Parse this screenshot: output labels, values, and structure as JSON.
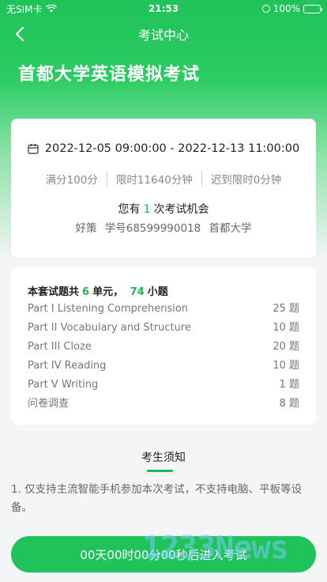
{
  "status_bar": {
    "carrier": "无SIM卡",
    "time": "21:53",
    "battery": "100%"
  },
  "nav": {
    "title": "考试中心"
  },
  "exam": {
    "title": "首都大学英语模拟考试",
    "time_range": "2022-12-05 09:00:00 - 2022-12-13 11:00:00",
    "full_score": "满分100分",
    "time_limit": "限时11640分钟",
    "late_limit": "迟到限时0分钟",
    "chance_prefix": "您有",
    "chance_count": "1",
    "chance_suffix": "次考试机会",
    "student_name": "好策",
    "student_id": "学号68599990018",
    "school": "首都大学"
  },
  "summary": {
    "prefix": "本套试题共",
    "units": "6",
    "units_label": "单元，",
    "questions": "74",
    "questions_label": "小题"
  },
  "parts": [
    {
      "name": "Part I Listening Comprehension",
      "count": "25 题"
    },
    {
      "name": "Part II Vocabulary and Structure",
      "count": "10 题"
    },
    {
      "name": "Part III Cloze",
      "count": "20 题"
    },
    {
      "name": "Part IV Reading",
      "count": "10 题"
    },
    {
      "name": "Part V Writing",
      "count": "1 题"
    },
    {
      "name": "问卷调查",
      "count": "8 题"
    }
  ],
  "notice": {
    "title": "考生须知",
    "text": "1. 仅支持主流智能手机参加本次考试，不支持电脑、平板等设备。"
  },
  "start_button": {
    "label": "00天00时00分00秒后进入考试"
  },
  "watermark": "1233News",
  "colors": {
    "accent": "#1fc35a",
    "highlight": "#1fb954"
  }
}
